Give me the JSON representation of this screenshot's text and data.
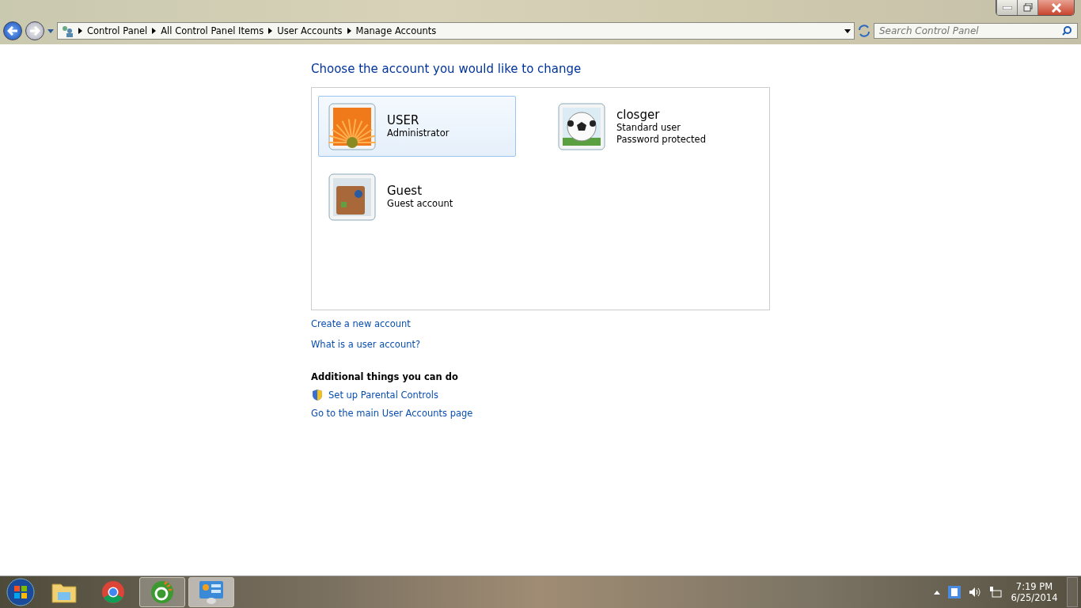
{
  "address_bar": {
    "breadcrumbs": [
      "Control Panel",
      "All Control Panel Items",
      "User Accounts",
      "Manage Accounts"
    ]
  },
  "search": {
    "placeholder": "Search Control Panel"
  },
  "heading": "Choose the account you would like to change",
  "accounts": [
    {
      "name": "USER",
      "details": [
        "Administrator"
      ],
      "kind": "flower",
      "selected": true
    },
    {
      "name": "closger",
      "details": [
        "Standard user",
        "Password protected"
      ],
      "kind": "ball",
      "selected": false
    },
    {
      "name": "Guest",
      "details": [
        "Guest account"
      ],
      "kind": "suitcase",
      "selected": false
    }
  ],
  "links": [
    "Create a new account",
    "What is a user account?"
  ],
  "additional": {
    "title": "Additional things you can do",
    "links": [
      {
        "label": "Set up Parental Controls",
        "shield": true
      },
      {
        "label": "Go to the main User Accounts page",
        "shield": false
      }
    ]
  },
  "taskbar": {
    "items": [
      {
        "kind": "explorer",
        "running": false,
        "selected": false
      },
      {
        "kind": "chrome",
        "running": false,
        "selected": false
      },
      {
        "kind": "green",
        "running": true,
        "selected": false
      },
      {
        "kind": "control",
        "running": true,
        "selected": true
      }
    ],
    "clock": {
      "time": "7:19 PM",
      "date": "6/25/2014"
    }
  }
}
